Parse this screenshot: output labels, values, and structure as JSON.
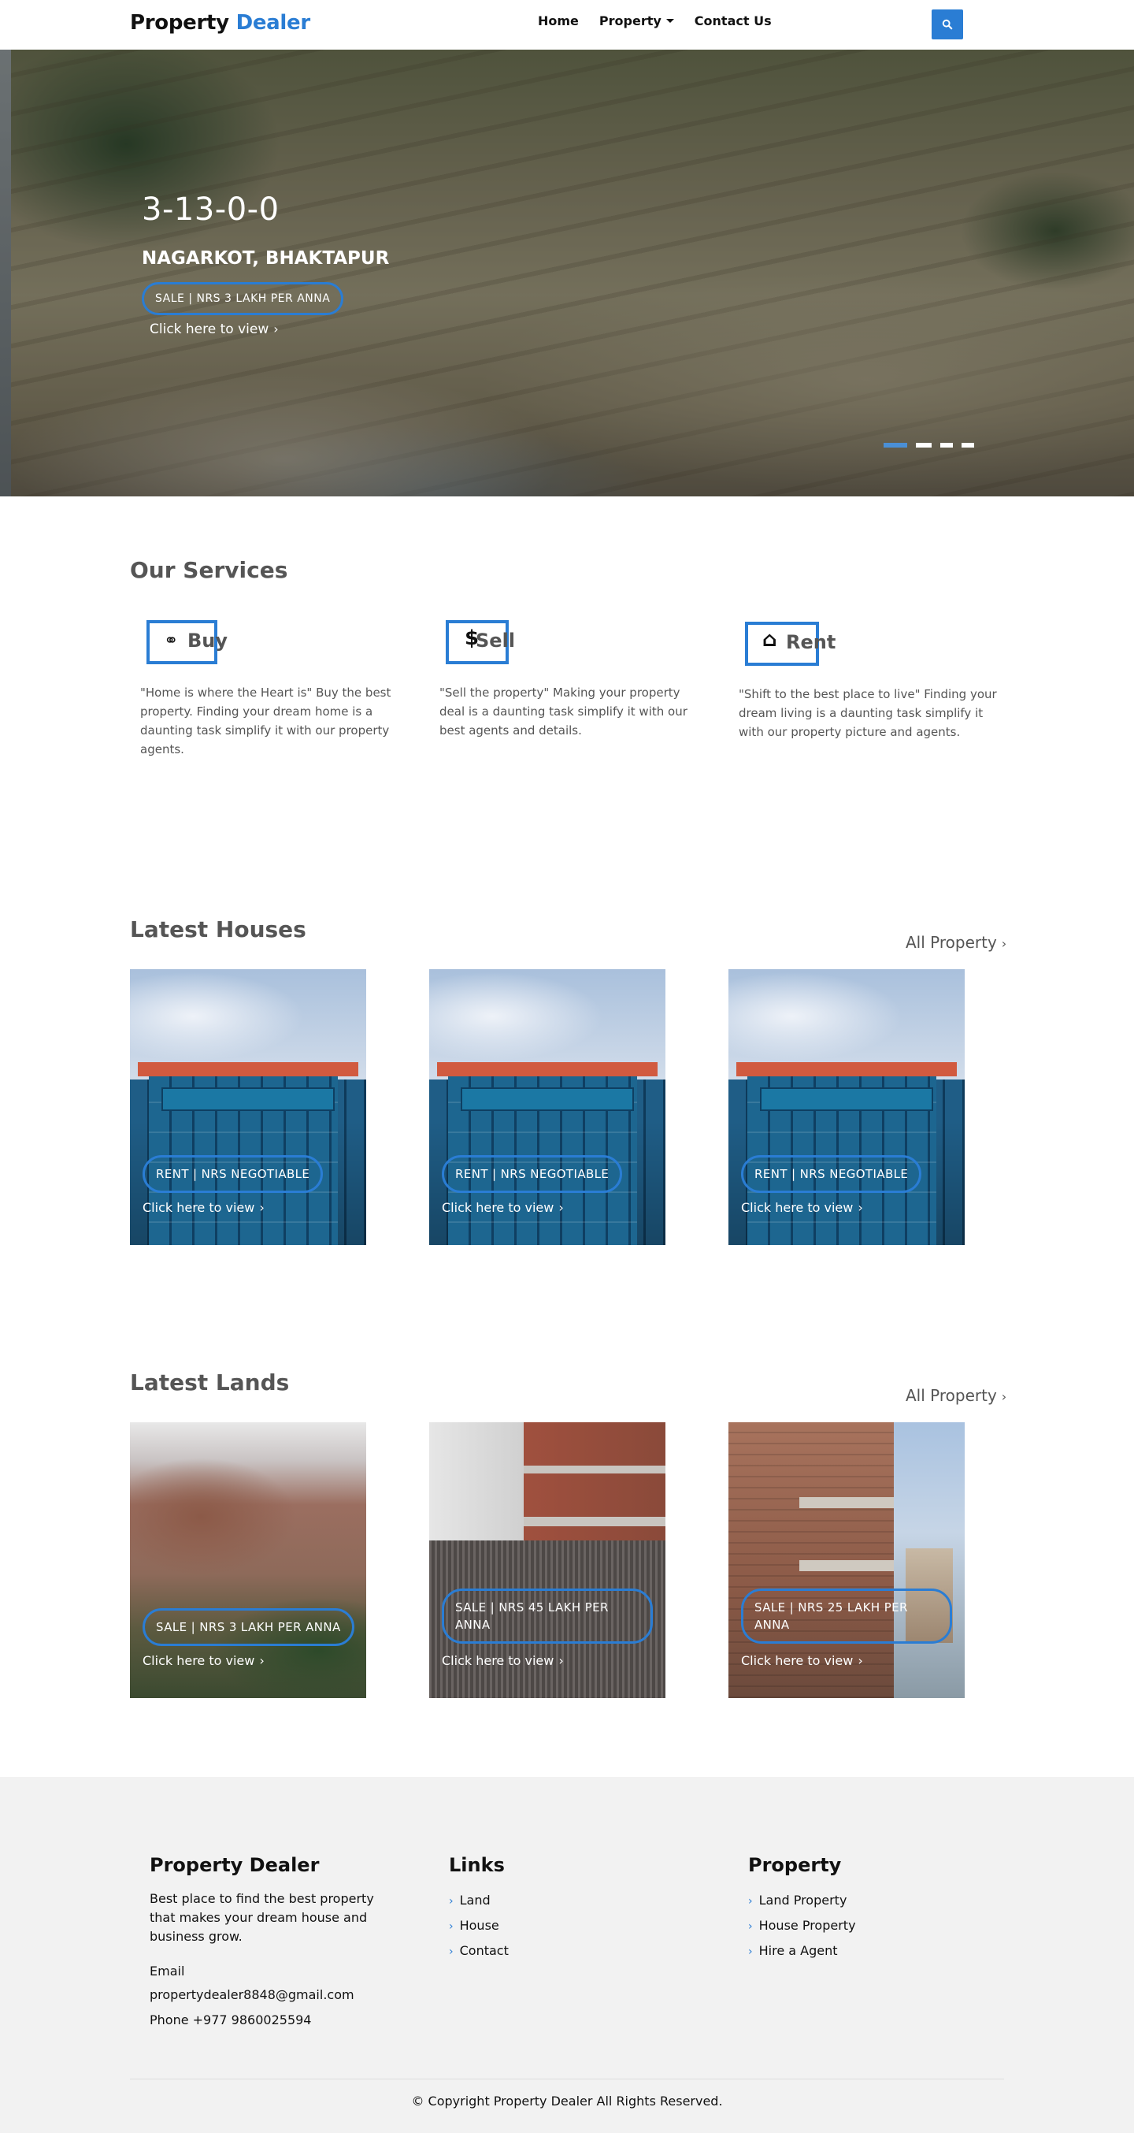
{
  "nav": {
    "brand_main": "Property",
    "brand_accent": "Dealer",
    "links": [
      "Home",
      "Property",
      "Contact Us"
    ]
  },
  "hero": {
    "code": "3-13-0-0",
    "location": "NAGARKOT, BHAKTAPUR",
    "badge": "SALE | NRS 3 LAKH PER ANNA",
    "link": "Click here to view",
    "indicator_count": 4,
    "active_indicator": 1
  },
  "services": {
    "title": "Our Services",
    "items": [
      {
        "name": "Buy",
        "icon": "handshake-icon",
        "glyph": "⚭",
        "desc": "\"Home is where the Heart is\" Buy the best property. Finding your dream home is a daunting task simplify it with our property agents."
      },
      {
        "name": "Sell",
        "icon": "dollar-icon",
        "glyph": "$",
        "desc": "\"Sell the property\" Making your property deal is a daunting task simplify it with our best agents and details."
      },
      {
        "name": "Rent",
        "icon": "home-icon",
        "glyph": "⌂",
        "desc": "\"Shift to the best place to live\" Finding your dream living is a daunting task simplify it with our property picture and agents."
      }
    ]
  },
  "houses": {
    "title": "Latest Houses",
    "all_link": "All Property",
    "cards": [
      {
        "badge": "RENT | NRS NEGOTIABLE",
        "link": "Click here to view"
      },
      {
        "badge": "RENT | NRS NEGOTIABLE",
        "link": "Click here to view"
      },
      {
        "badge": "RENT | NRS NEGOTIABLE",
        "link": "Click here to view"
      }
    ]
  },
  "lands": {
    "title": "Latest Lands",
    "all_link": "All Property",
    "cards": [
      {
        "badge": "SALE | NRS 3 LAKH PER ANNA",
        "link": "Click here to view"
      },
      {
        "badge": "SALE | NRS 45 LAKH PER ANNA",
        "link": "Click here to view"
      },
      {
        "badge": "SALE | NRS 25 LAKH PER ANNA",
        "link": "Click here to view"
      }
    ]
  },
  "footer": {
    "about_title": "Property Dealer",
    "about_text": "Best place to find the best property that makes your dream house and business grow.",
    "email_label": "Email",
    "email": "propertydealer8848@gmail.com",
    "phone": "Phone +977 9860025594",
    "links_title": "Links",
    "links": [
      "Land",
      "House",
      "Contact"
    ],
    "property_title": "Property",
    "property_links": [
      "Land Property",
      "House Property",
      "Hire a Agent"
    ],
    "copyright": "© Copyright Property Dealer All Rights Reserved."
  },
  "colors": {
    "accent": "#2a7dd4",
    "footer_bg": "#f2f2f2"
  }
}
